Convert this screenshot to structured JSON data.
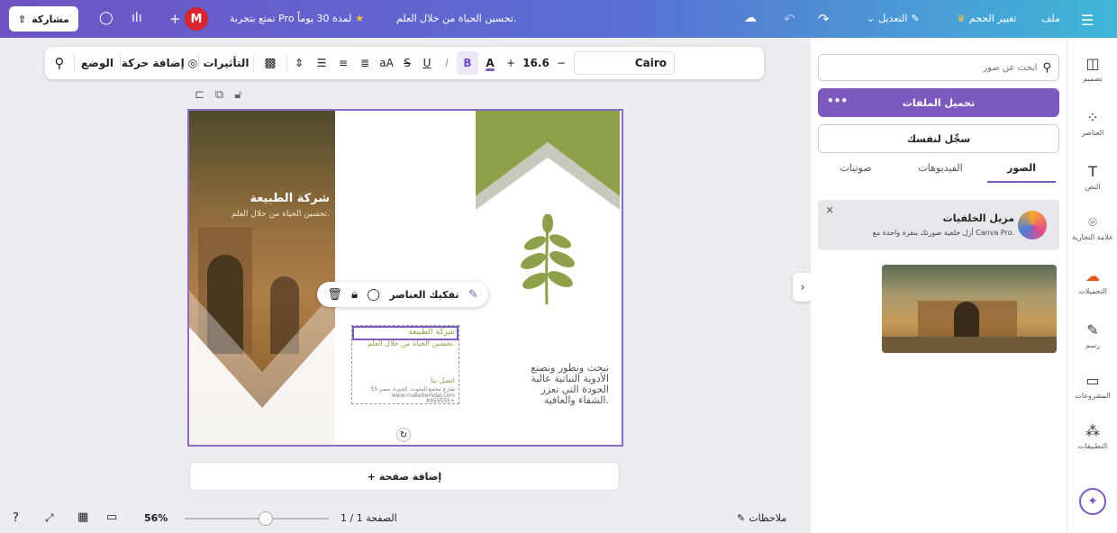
{
  "topbar": {
    "menu_icon": "hamburger-icon",
    "file_label": "ملف",
    "resize_label": "تغيير الحجم",
    "edit_label": "التعديل",
    "doc_title": "تحسين الحياة من خلال العلم.",
    "promo_label": "تمتع بتجربة Pro لمدة 30 يوماً",
    "avatar_letter": "M",
    "add_label": "+",
    "share_label": "مشاركة"
  },
  "format_toolbar": {
    "font_name": "Cairo",
    "font_size": "16.6",
    "minus": "−",
    "plus": "+",
    "bold": "B",
    "italic": "I",
    "underline": "U",
    "strike": "S",
    "case": "aA",
    "effects_label": "التأثيرات",
    "animate_label": "إضافة حركة",
    "position_label": "الوضع"
  },
  "panel": {
    "search_placeholder": "ابحث عن صور",
    "upload_label": "تحميل الملفات",
    "record_label": "سجِّل لنفسك",
    "tabs": [
      {
        "label": "الصور",
        "active": true
      },
      {
        "label": "الفيديوهات",
        "active": false
      },
      {
        "label": "صوتيات",
        "active": false
      }
    ],
    "promo_title": "مزيل الخلفيات",
    "promo_desc": "أزل خلفية صورتك بنقرة واحدة مع Canva Pro."
  },
  "rail": [
    {
      "label": "تصميم",
      "icon": "layout-icon"
    },
    {
      "label": "العناصر",
      "icon": "elements-icon"
    },
    {
      "label": "النص",
      "icon": "text-icon"
    },
    {
      "label": "علامة التجارية",
      "icon": "brand-icon"
    },
    {
      "label": "التحميلات",
      "icon": "cloud-upload-icon"
    },
    {
      "label": "رسم",
      "icon": "draw-icon"
    },
    {
      "label": "المشروعات",
      "icon": "folder-icon"
    },
    {
      "label": "التطبيقات",
      "icon": "apps-icon"
    }
  ],
  "canvas": {
    "brand_name": "شركة الطبيعة",
    "tagline": "تحسين الحياة من خلال العلم.",
    "context_menu_label": "تفكيك العناصر",
    "body_text": [
      "نبحث ونطور ونصنع",
      "الأدوية النباتية عالية",
      "الجودة التي تعزز",
      "الشفاء والعافية."
    ],
    "contact_title": "اتصل بنا",
    "contact_line1": "55 شارع مجمع البحوث، الجيزة، مصر",
    "contact_line2": "www.makeitemdaj.com",
    "contact_line3": "8955555+",
    "add_page_label": "+ إضافة صفحة"
  },
  "bottombar": {
    "notes_label": "ملاحظات",
    "page_indicator": "الصفحة 1 / 1",
    "zoom": "56%",
    "zoom_fraction": 0.56
  },
  "colors": {
    "accent": "#7d5bbe",
    "olive": "#8fa04a",
    "gray_chevron": "#c8c9bd"
  }
}
